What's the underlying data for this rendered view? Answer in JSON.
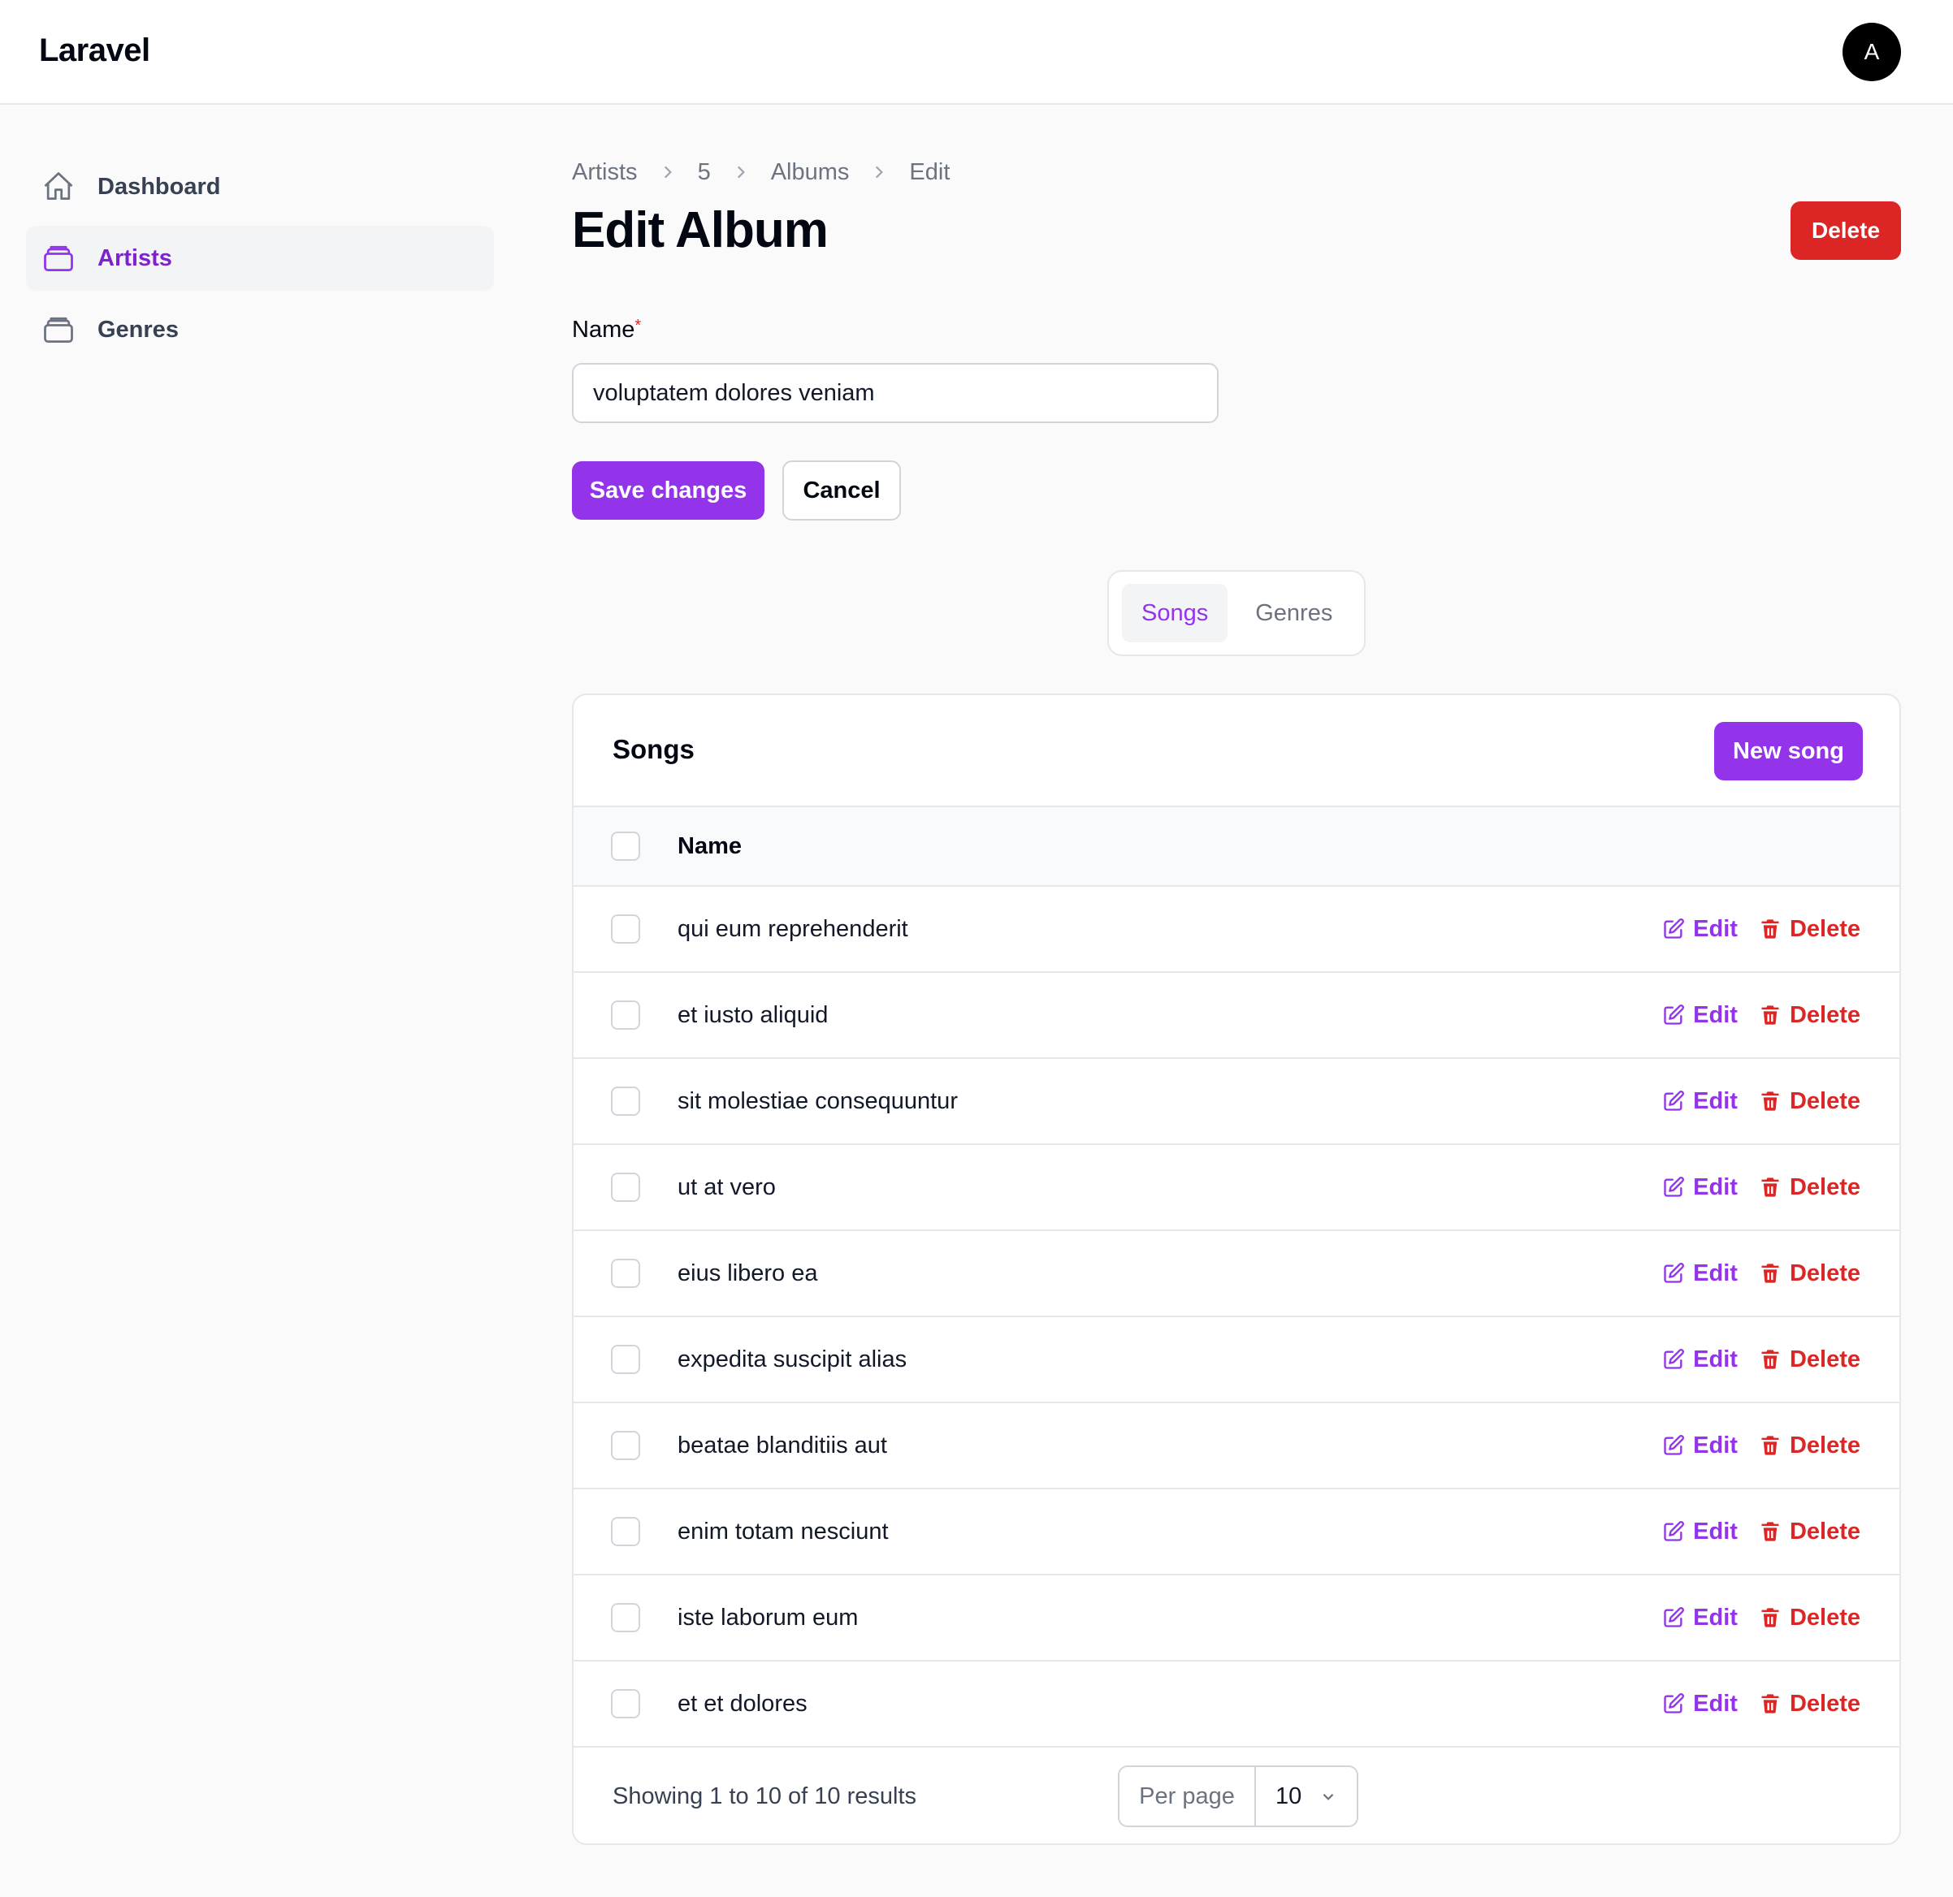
{
  "header": {
    "brand": "Laravel",
    "avatar_initial": "A"
  },
  "sidebar": {
    "items": [
      {
        "label": "Dashboard",
        "icon": "home-icon",
        "active": false
      },
      {
        "label": "Artists",
        "icon": "rectangle-stack-icon",
        "active": true
      },
      {
        "label": "Genres",
        "icon": "rectangle-stack-icon",
        "active": false
      }
    ]
  },
  "breadcrumb": [
    "Artists",
    "5",
    "Albums",
    "Edit"
  ],
  "page": {
    "title": "Edit Album",
    "delete_label": "Delete"
  },
  "form": {
    "name_label": "Name",
    "required_mark": "*",
    "name_value": "voluptatem dolores veniam",
    "save_label": "Save changes",
    "cancel_label": "Cancel"
  },
  "tabs": [
    {
      "label": "Songs",
      "active": true
    },
    {
      "label": "Genres",
      "active": false
    }
  ],
  "songs_table": {
    "title": "Songs",
    "new_label": "New song",
    "column_name": "Name",
    "edit_label": "Edit",
    "delete_label": "Delete",
    "rows": [
      "qui eum reprehenderit",
      "et iusto aliquid",
      "sit molestiae consequuntur",
      "ut at vero",
      "eius libero ea",
      "expedita suscipit alias",
      "beatae blanditiis aut",
      "enim totam nesciunt",
      "iste laborum eum",
      "et et dolores"
    ],
    "results_text": "Showing 1 to 10 of 10 results",
    "per_page_label": "Per page",
    "per_page_value": "10"
  },
  "colors": {
    "accent": "#9333ea",
    "danger": "#dc2626"
  }
}
